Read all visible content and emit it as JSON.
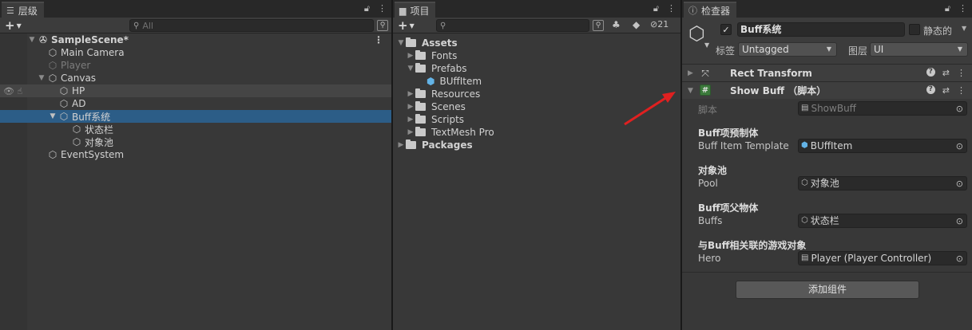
{
  "hierarchy": {
    "tab_label": "层级",
    "search_placeholder": "All",
    "scene_name": "SampleScene*",
    "items": [
      {
        "label": "Main Camera"
      },
      {
        "label": "Player"
      },
      {
        "label": "Canvas"
      },
      {
        "label": "HP"
      },
      {
        "label": "AD"
      },
      {
        "label": "Buff系统"
      },
      {
        "label": "状态栏"
      },
      {
        "label": "对象池"
      },
      {
        "label": "EventSystem"
      }
    ]
  },
  "project": {
    "tab_label": "项目",
    "hidden_count": "21",
    "items": [
      {
        "label": "Assets"
      },
      {
        "label": "Fonts"
      },
      {
        "label": "Prefabs"
      },
      {
        "label": "BUffItem"
      },
      {
        "label": "Resources"
      },
      {
        "label": "Scenes"
      },
      {
        "label": "Scripts"
      },
      {
        "label": "TextMesh Pro"
      },
      {
        "label": "Packages"
      }
    ]
  },
  "inspector": {
    "tab_label": "检查器",
    "object_name": "Buff系统",
    "static_label": "静态的",
    "tag_label": "标签",
    "tag_value": "Untagged",
    "layer_label": "图层",
    "layer_value": "UI",
    "components": [
      {
        "name": "Rect Transform"
      },
      {
        "name": "Show Buff （脚本）"
      }
    ],
    "script_label": "脚本",
    "script_value": "ShowBuff",
    "sections": [
      {
        "header": "Buff项预制体",
        "label": "Buff Item Template",
        "value": "BUffItem"
      },
      {
        "header": "对象池",
        "label": "Pool",
        "value": "对象池"
      },
      {
        "header": "Buff项父物体",
        "label": "Buffs",
        "value": "状态栏"
      },
      {
        "header": "与Buff相关联的游戏对象",
        "label": "Hero",
        "value": "Player (Player Controller)"
      }
    ],
    "add_component_label": "添加组件"
  },
  "colors": {
    "selection": "#2c5d87",
    "panel_bg": "#383838",
    "prefab_blue": "#63b3e6",
    "annotation_arrow": "#e02020"
  }
}
